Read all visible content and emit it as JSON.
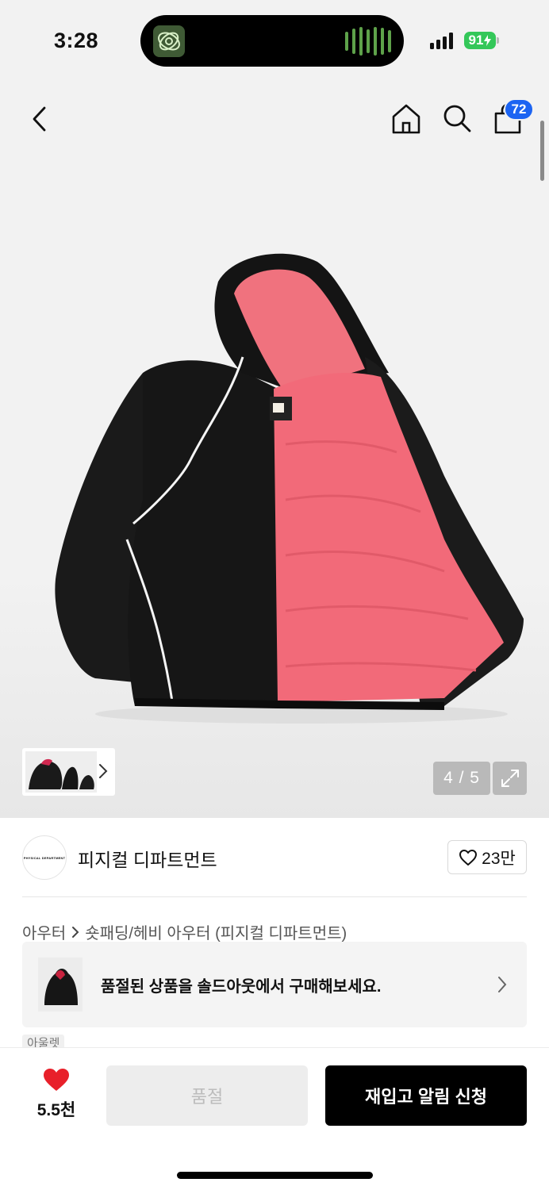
{
  "status_bar": {
    "time": "3:28",
    "battery": "91"
  },
  "nav": {
    "back_icon": "chevron-left-icon",
    "home_icon": "home-icon",
    "search_icon": "search-icon",
    "cart_icon": "shopping-bag-icon",
    "cart_count": "72"
  },
  "gallery": {
    "counter": "4 / 5",
    "current_index": 4,
    "total": 5,
    "expand_icon": "expand-icon"
  },
  "brand": {
    "logo_text": "PHYSICAL DEPARTMENT",
    "name": "피지컬 디파트먼트",
    "like_count": "23만"
  },
  "breadcrumb": {
    "category": "아우터",
    "subcategory": "숏패딩/헤비 아우터 (피지컬 디파트먼트)"
  },
  "sold_banner": {
    "text": "품절된 상품을 솔드아웃에서 구매해보세요."
  },
  "tag_partial": "아울렛",
  "bottom_bar": {
    "wish_count": "5.5천",
    "soldout_label": "품절",
    "restock_label": "재입고 알림 신청"
  },
  "colors": {
    "accent_blue": "#1c64f2",
    "heart_red": "#e8202a",
    "battery_green": "#34c759",
    "primary_button": "#000000"
  }
}
